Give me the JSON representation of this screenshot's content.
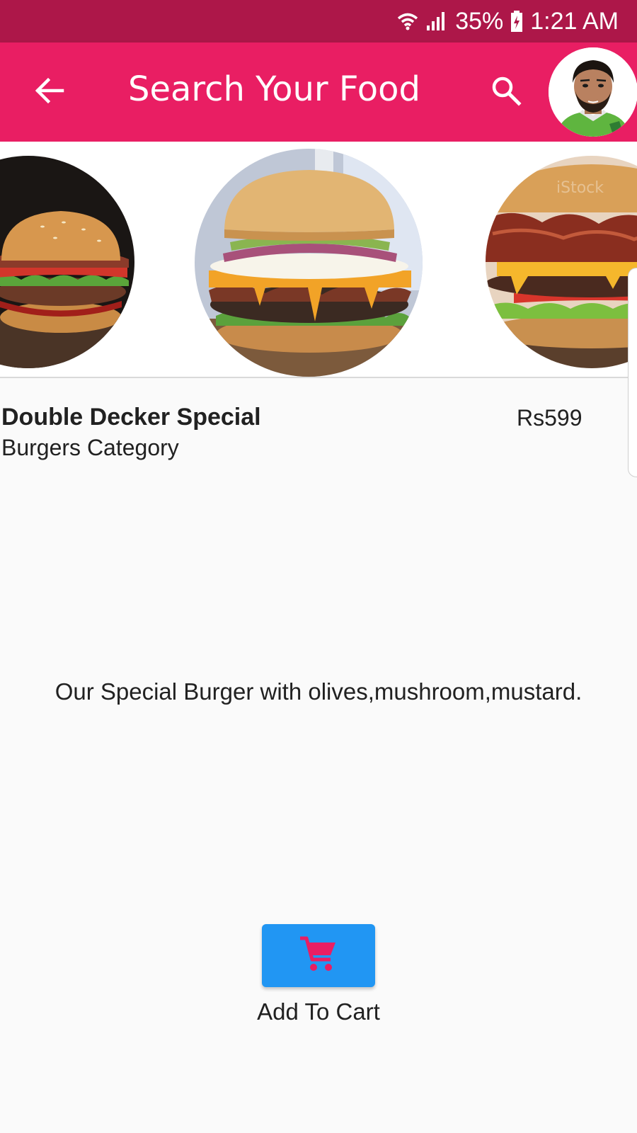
{
  "status_bar": {
    "battery": "35%",
    "time": "1:21 AM",
    "icons": [
      "wifi-icon",
      "signal-icon",
      "battery-charging-icon"
    ]
  },
  "app_bar": {
    "title": "Search Your Food",
    "back_icon": "arrow-back-icon",
    "search_icon": "search-icon",
    "avatar": "profile-avatar"
  },
  "carousel": {
    "images": [
      "burger-image",
      "double-decker-burger-image",
      "bacon-burger-image"
    ]
  },
  "item": {
    "name": "Double Decker Special",
    "category": "Burgers Category",
    "price": "Rs599",
    "description": "Our Special Burger with olives,mushroom,mustard."
  },
  "cart": {
    "icon": "cart-icon",
    "label": "Add To Cart"
  },
  "colors": {
    "status_bar": "#ad1749",
    "app_bar": "#e91e63",
    "cart_button": "#2196f3",
    "cart_icon": "#e91e63",
    "background": "#fafafa"
  }
}
